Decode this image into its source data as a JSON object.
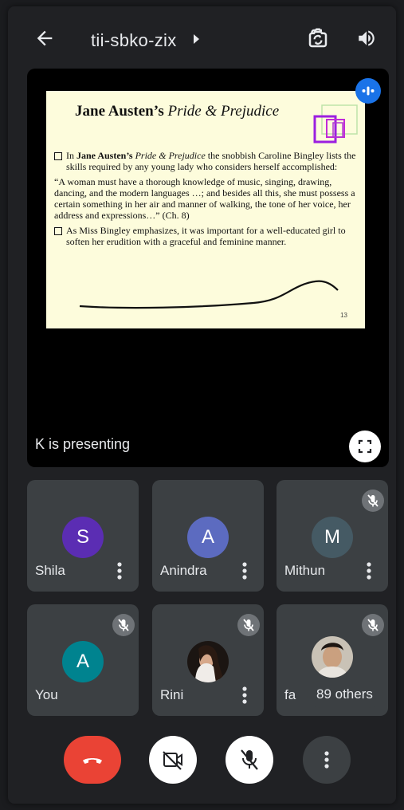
{
  "header": {
    "meeting_code": "tii-sbko-zix"
  },
  "presentation": {
    "status": "K is presenting",
    "slide": {
      "title_author": "Jane Austen’s",
      "title_work": "Pride & Prejudice",
      "bullet1_a": "In ",
      "bullet1_author": "Jane Austen’s ",
      "bullet1_work": "Pride & Prejudice",
      "bullet1_b": " the snobbish Caroline Bingley lists the skills required by any young lady who considers herself accomplished:",
      "quote": "“A woman must have a thorough knowledge of music, singing, drawing, dancing, and the modern languages …; and besides all this, she must possess a certain something in her air and manner of walking, the tone of her voice, her address and expressions…” (Ch. 8)",
      "bullet2": "As Miss Bingley emphasizes, it was important for a well-educated girl to soften her erudition with a graceful and feminine manner.",
      "page_number": "13"
    }
  },
  "participants": [
    {
      "initial": "S",
      "name": "Shila",
      "color": "#5b2db3"
    },
    {
      "initial": "A",
      "name": "Anindra",
      "color": "#5c6bc0"
    },
    {
      "initial": "M",
      "name": "Mithun",
      "color": "#455a64"
    },
    {
      "initial": "A",
      "name": "You",
      "color": "#00838f"
    },
    {
      "initial": "",
      "name": "Rini",
      "color": "#000000"
    },
    {
      "initial": "",
      "name": "fa",
      "color": "#000000"
    }
  ],
  "others_label": "89 others",
  "colors": {
    "hangup": "#ea4335",
    "speaking": "#1a73e8",
    "tile": "#3c4043",
    "background": "#202124"
  }
}
